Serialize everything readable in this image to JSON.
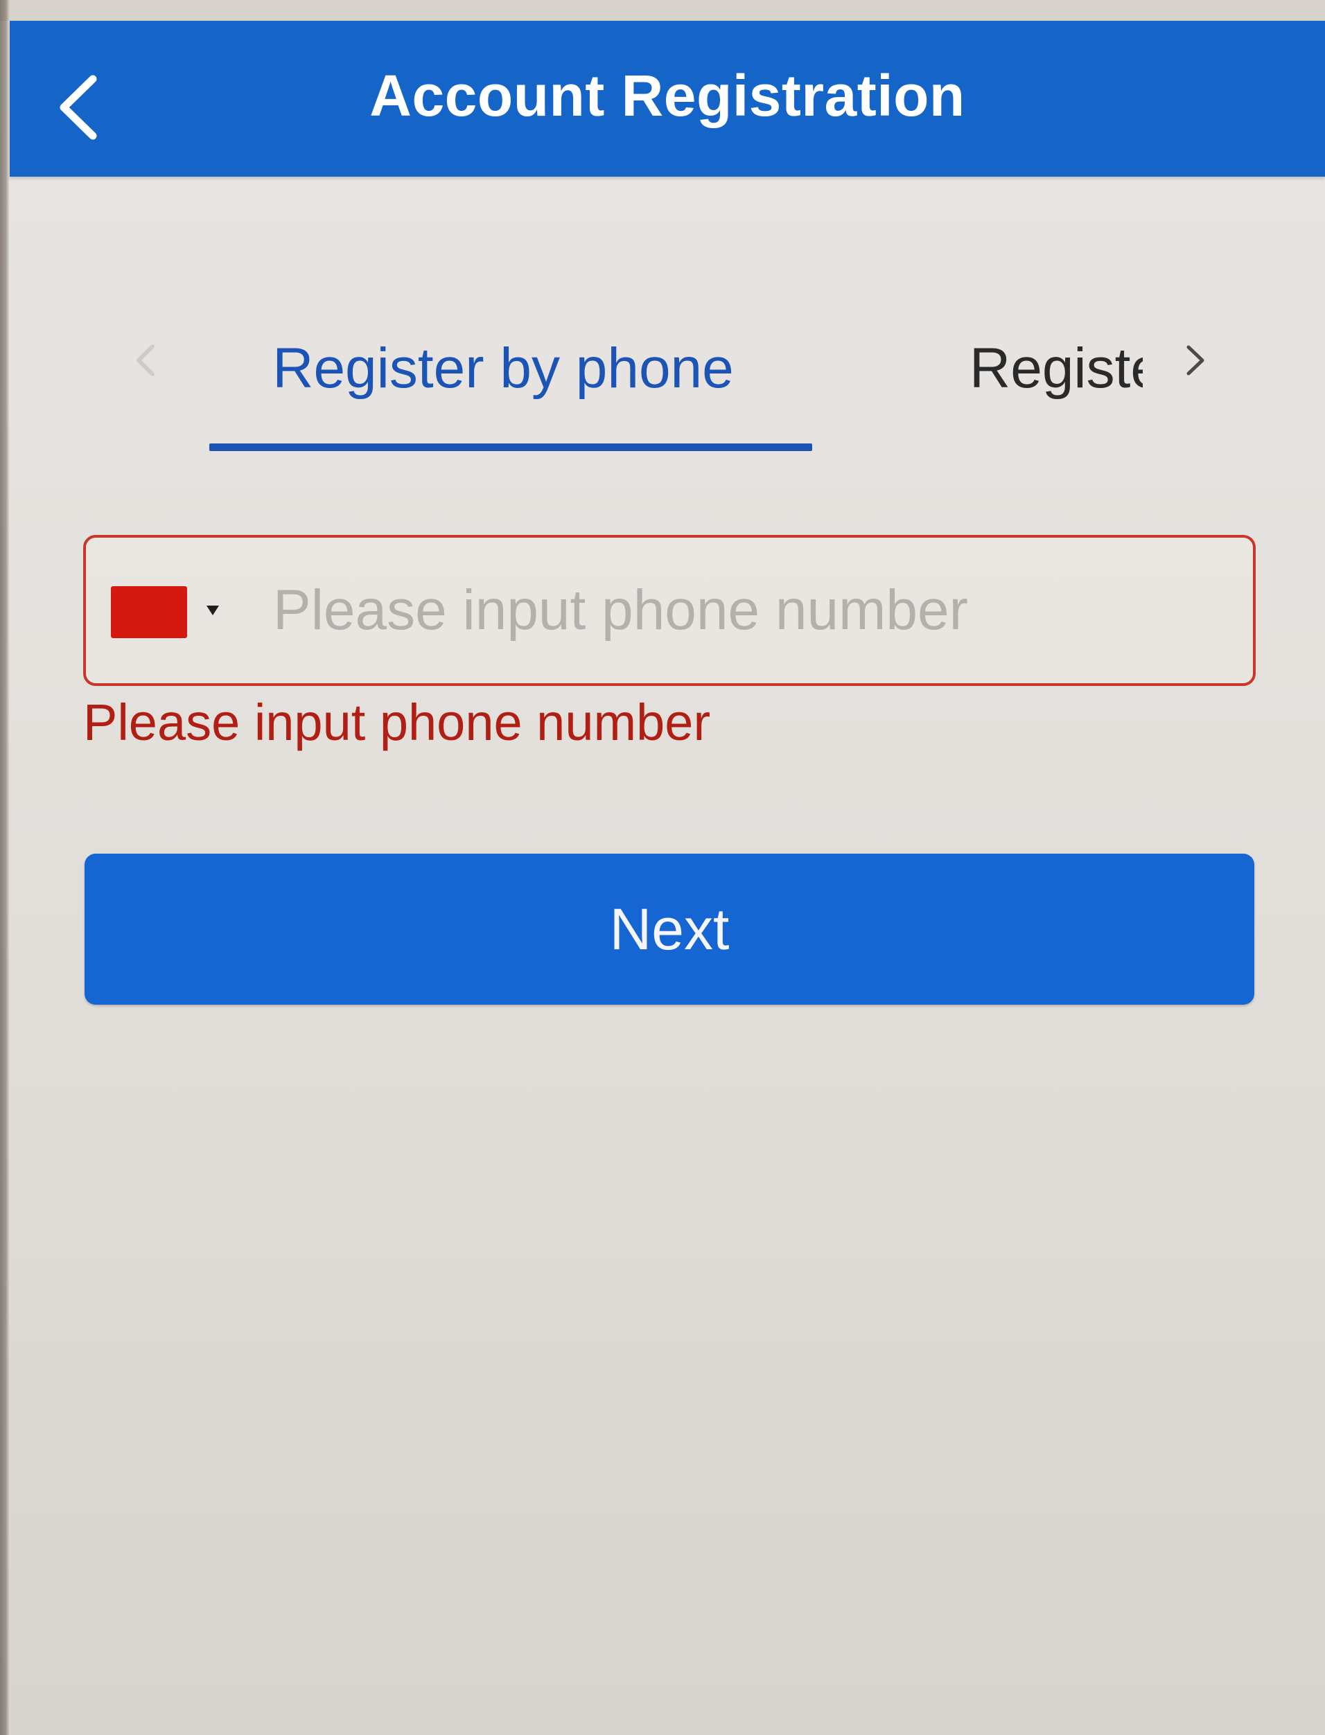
{
  "header": {
    "title": "Account Registration",
    "back_icon": "chevron-left-icon",
    "background_color": "#1565c9"
  },
  "tabs": {
    "items": [
      {
        "label": "Register by phone",
        "active": true
      },
      {
        "label": "Registe",
        "active": false
      }
    ],
    "prev_icon": "chevron-left-icon",
    "next_icon": "chevron-right-icon",
    "active_color": "#1c54b6"
  },
  "phone_field": {
    "country_flag_icon": "china-flag-icon",
    "dropdown_icon": "caret-down-icon",
    "placeholder": "Please input phone number",
    "value": "",
    "border_color": "#c9372c"
  },
  "error_message": "Please input phone number",
  "next_button": {
    "label": "Next",
    "color": "#1565d3"
  }
}
